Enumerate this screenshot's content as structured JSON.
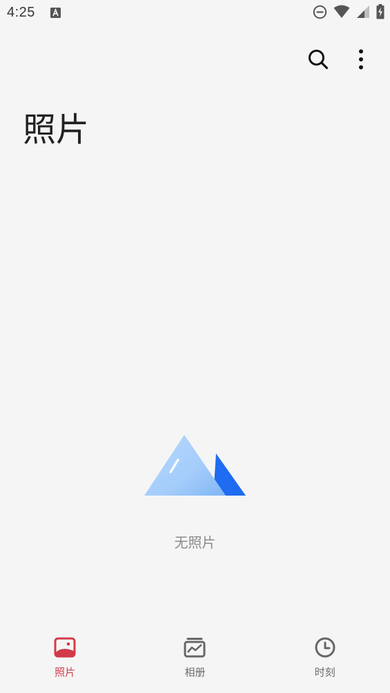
{
  "status_bar": {
    "time": "4:25",
    "icons": [
      "a-notification-icon",
      "do-not-disturb-icon",
      "wifi-icon",
      "signal-icon",
      "battery-charging-icon"
    ]
  },
  "toolbar": {
    "search_icon": "search-icon",
    "more_icon": "more-vert-icon"
  },
  "page": {
    "title": "照片"
  },
  "empty_state": {
    "icon": "mountain-image-icon",
    "message": "无照片"
  },
  "bottom_nav": {
    "items": [
      {
        "label": "照片",
        "icon": "photo-icon",
        "active": true
      },
      {
        "label": "相册",
        "icon": "album-icon",
        "active": false
      },
      {
        "label": "时刻",
        "icon": "clock-icon",
        "active": false
      }
    ]
  },
  "colors": {
    "background": "#f5f5f5",
    "accent": "#d23a49",
    "text_primary": "#222222",
    "text_secondary": "#8a8a8a",
    "mountain_light": "#a9d0fb",
    "mountain_dark": "#1f6bf1"
  }
}
